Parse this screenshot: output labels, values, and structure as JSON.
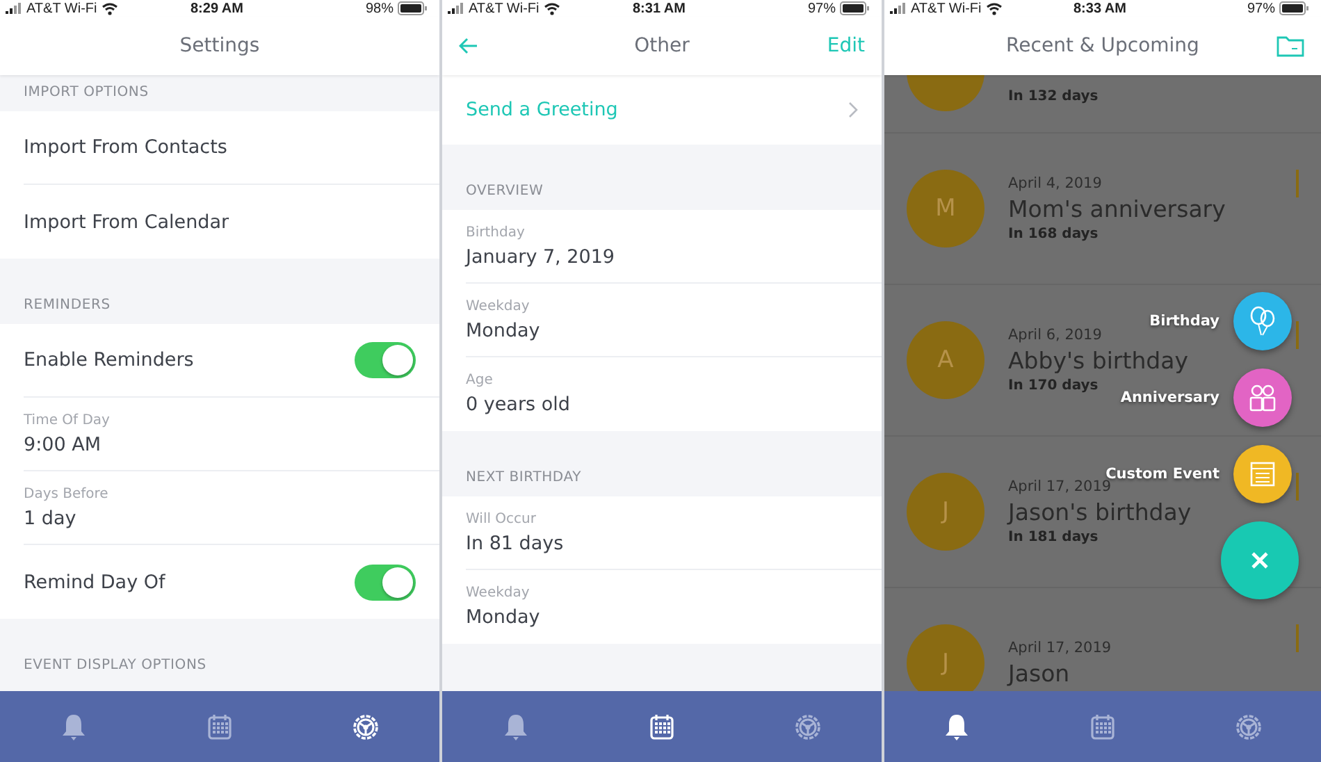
{
  "panels": [
    {
      "status": {
        "carrier": "AT&T Wi-Fi",
        "time": "8:29 AM",
        "battery": "98%"
      },
      "nav": {
        "title": "Settings"
      },
      "sections": [
        {
          "header": "IMPORT OPTIONS",
          "rows": [
            {
              "kind": "link",
              "label": "Import From Contacts"
            },
            {
              "kind": "link",
              "label": "Import From Calendar"
            }
          ]
        },
        {
          "header": "REMINDERS",
          "rows": [
            {
              "kind": "toggle",
              "label": "Enable Reminders",
              "on": true
            },
            {
              "kind": "value",
              "label": "Time Of Day",
              "value": "9:00 AM"
            },
            {
              "kind": "value",
              "label": "Days Before",
              "value": "1 day"
            },
            {
              "kind": "toggle",
              "label": "Remind Day Of",
              "on": true
            }
          ]
        },
        {
          "header": "EVENT DISPLAY OPTIONS"
        }
      ],
      "tabs": [
        {
          "kind": "bell",
          "selected": false
        },
        {
          "kind": "calendar",
          "selected": false
        },
        {
          "kind": "wheel",
          "selected": true
        }
      ]
    },
    {
      "status": {
        "carrier": "AT&T Wi-Fi",
        "time": "8:31 AM",
        "battery": "97%"
      },
      "nav": {
        "title": "Other",
        "back_button": true,
        "action": "Edit"
      },
      "sections": [
        {
          "rows": [
            {
              "kind": "accent-link",
              "label": "Send a Greeting"
            }
          ]
        },
        {
          "header": "OVERVIEW",
          "rows": [
            {
              "kind": "value",
              "label": "Birthday",
              "value": "January 7, 2019"
            },
            {
              "kind": "value",
              "label": "Weekday",
              "value": "Monday"
            },
            {
              "kind": "value",
              "label": "Age",
              "value": "0 years old"
            }
          ]
        },
        {
          "header": "NEXT BIRTHDAY",
          "rows": [
            {
              "kind": "value",
              "label": "Will Occur",
              "value": "In 81 days"
            },
            {
              "kind": "value",
              "label": "Weekday",
              "value": "Monday"
            }
          ]
        }
      ],
      "tabs": [
        {
          "kind": "bell",
          "selected": false
        },
        {
          "kind": "calendar",
          "selected": true
        },
        {
          "kind": "wheel",
          "selected": false
        }
      ]
    },
    {
      "status": {
        "carrier": "AT&T Wi-Fi",
        "time": "8:33 AM",
        "battery": "97%"
      },
      "nav": {
        "title": "Recent & Upcoming",
        "folder_button": true
      },
      "events": [
        {
          "kind": "partial",
          "days": "In 132 days"
        },
        {
          "kind": "full",
          "initial": "M",
          "date": "April 4, 2019",
          "name": "Mom's anniversary",
          "days": "In 168 days"
        },
        {
          "kind": "full",
          "initial": "A",
          "date": "April 6, 2019",
          "name": "Abby's birthday",
          "days": "In 170 days"
        },
        {
          "kind": "full",
          "initial": "J",
          "date": "April 17, 2019",
          "name": "Jason's birthday",
          "days": "In 181 days"
        },
        {
          "kind": "full",
          "initial": "J",
          "date": "April 17, 2019",
          "name": "Jason"
        }
      ],
      "fab_menu": {
        "open": true,
        "items": [
          {
            "kind": "balloons",
            "label": "Birthday",
            "color": "#2cb6e8"
          },
          {
            "kind": "couple",
            "label": "Anniversary",
            "color": "#e264c4"
          },
          {
            "kind": "calendar-list",
            "label": "Custom Event",
            "color": "#f0b824"
          }
        ]
      },
      "tabs": [
        {
          "kind": "bell",
          "selected": true
        },
        {
          "kind": "calendar",
          "selected": false
        },
        {
          "kind": "wheel",
          "selected": false
        }
      ]
    }
  ]
}
